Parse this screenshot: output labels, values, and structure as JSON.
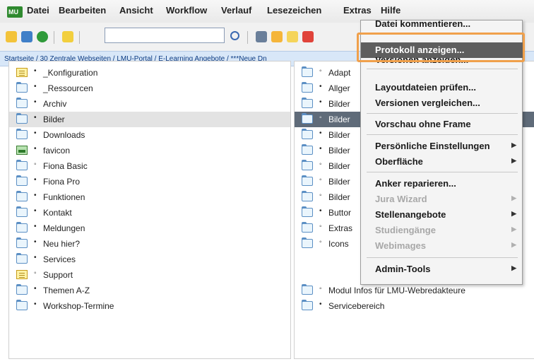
{
  "menubar": {
    "items": [
      "Datei",
      "Bearbeiten",
      "Ansicht",
      "Workflow",
      "Verlauf",
      "Lesezeichen",
      "Extras",
      "Hilfe"
    ]
  },
  "toolbar": {
    "search_value": "",
    "icons": [
      "edit-icon",
      "folder-new-icon",
      "globe-icon",
      "check-icon",
      "search-icon",
      "cut-icon",
      "copy-icon",
      "paste-icon",
      "delete-icon"
    ]
  },
  "breadcrumb": "Startseite / 30 Zentrale Webseiten / LMU-Portal / E-Learning Angebote / ***Neue Dn",
  "left_panel": {
    "rows": [
      {
        "label": "_Konfiguration",
        "icon": "doc",
        "bullet": "•"
      },
      {
        "label": "_Ressourcen",
        "icon": "folder",
        "bullet": "•"
      },
      {
        "label": "Archiv",
        "icon": "folder",
        "bullet": "•"
      },
      {
        "label": "Bilder",
        "icon": "folder",
        "bullet": "•",
        "selected": true
      },
      {
        "label": "Downloads",
        "icon": "folder",
        "bullet": "•"
      },
      {
        "label": "favicon",
        "icon": "image",
        "bullet": "•"
      },
      {
        "label": "Fiona Basic",
        "icon": "folder",
        "bullet": "◦"
      },
      {
        "label": "Fiona Pro",
        "icon": "folder",
        "bullet": "•"
      },
      {
        "label": "Funktionen",
        "icon": "folder",
        "bullet": "•"
      },
      {
        "label": "Kontakt",
        "icon": "folder",
        "bullet": "•"
      },
      {
        "label": "Meldungen",
        "icon": "folder",
        "bullet": "•"
      },
      {
        "label": "Neu hier?",
        "icon": "folder",
        "bullet": "•"
      },
      {
        "label": "Services",
        "icon": "folder",
        "bullet": "•"
      },
      {
        "label": "Support",
        "icon": "doc",
        "bullet": "◦"
      },
      {
        "label": "Themen A-Z",
        "icon": "folder",
        "bullet": "•"
      },
      {
        "label": "Workshop-Termine",
        "icon": "folder",
        "bullet": "•"
      }
    ]
  },
  "right_panel": {
    "rows": [
      {
        "label": "Adapt",
        "bullet": "◦"
      },
      {
        "label": "Allger",
        "bullet": "•"
      },
      {
        "label": "Bilder",
        "bullet": "•"
      },
      {
        "label": "Bilder",
        "bullet": "◦",
        "selected": true
      },
      {
        "label": "Bilder",
        "bullet": "•"
      },
      {
        "label": "Bilder",
        "bullet": "•"
      },
      {
        "label": "Bilder",
        "bullet": "◦"
      },
      {
        "label": "Bilder",
        "bullet": "◦"
      },
      {
        "label": "Bilder",
        "bullet": "◦"
      },
      {
        "label": "Buttor",
        "bullet": "•"
      },
      {
        "label": "Extras",
        "bullet": "◦"
      },
      {
        "label": "Icons",
        "bullet": "◦"
      },
      {
        "label": "Modul Infos für LMU-Webredakteure",
        "bullet": "◦"
      },
      {
        "label": "Servicebereich",
        "bullet": "•"
      }
    ]
  },
  "dropdown": {
    "items": [
      {
        "label": "Datei kommentieren...",
        "top": 0
      },
      {
        "label": "Protokoll anzeigen...",
        "highlight": true
      },
      {
        "label": "Versionen anzeigen..."
      },
      {
        "label": "Layoutdateien prüfen..."
      },
      {
        "label": "Versionen vergleichen..."
      },
      {
        "label": "Vorschau ohne Frame"
      },
      {
        "label": "Persönliche Einstellungen",
        "submenu": true
      },
      {
        "label": "Oberfläche",
        "submenu": true
      },
      {
        "label": "Anker reparieren..."
      },
      {
        "label": "Jura Wizard",
        "submenu": true,
        "disabled": true
      },
      {
        "label": "Stellenangebote",
        "submenu": true
      },
      {
        "label": "Studiengänge",
        "submenu": true,
        "disabled": true
      },
      {
        "label": "Webimages",
        "submenu": true,
        "disabled": true
      },
      {
        "label": "Admin-Tools",
        "submenu": true
      }
    ]
  }
}
